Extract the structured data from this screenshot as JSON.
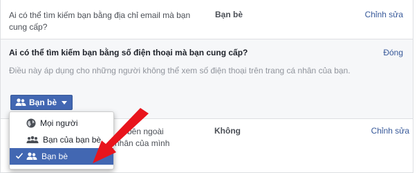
{
  "rows": {
    "email": {
      "question": "Ai có thể tìm kiếm bạn bằng địa chỉ email mà bạn cung cấp?",
      "value": "Bạn bè",
      "edit_label": "Chỉnh sửa"
    },
    "phone": {
      "question": "Ai có thể tìm kiếm bạn bằng số điện thoại mà bạn cung cấp?",
      "close_label": "Đóng",
      "description": "Điều này áp dụng cho những người không thể xem số điện thoại trên trang cá nhân của bạn.",
      "button_label": "Bạn bè"
    },
    "search": {
      "question_line1": "bên ngoài",
      "question_line2": "nhân của mình",
      "value": "Không",
      "edit_label": "Chỉnh sửa"
    }
  },
  "menu": {
    "items": [
      {
        "label": "Mọi người",
        "icon": "globe-icon",
        "selected": false
      },
      {
        "label": "Bạn của bạn bè",
        "icon": "friends-icon",
        "selected": false
      },
      {
        "label": "Bạn bè",
        "icon": "friends-icon",
        "selected": true
      }
    ]
  },
  "colors": {
    "link": "#365899",
    "button_blue": "#4267b2",
    "arrow_red": "#e8141c"
  }
}
